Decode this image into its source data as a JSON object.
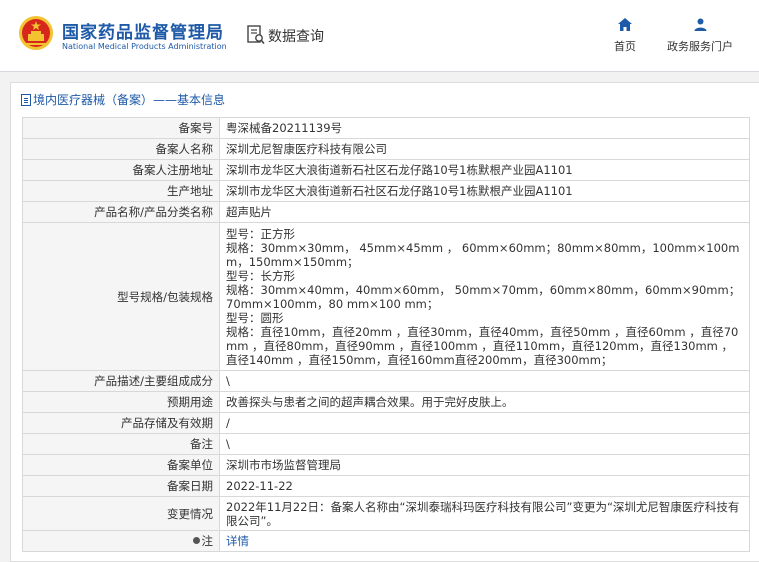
{
  "header": {
    "site_name_cn": "国家药品监督管理局",
    "site_name_en": "National Medical Products Administration",
    "section_title": "数据查询",
    "nav": {
      "home_label": "首页",
      "service_label": "政务服务门户"
    }
  },
  "breadcrumb": {
    "parent": "境内医疗器械（备案）",
    "separator": "——",
    "current": "基本信息"
  },
  "record": {
    "filing_no": {
      "label": "备案号",
      "value": "粤深械备20211139号"
    },
    "filer_name": {
      "label": "备案人名称",
      "value": "深圳尤尼智康医疗科技有限公司"
    },
    "filer_address": {
      "label": "备案人注册地址",
      "value": "深圳市龙华区大浪街道新石社区石龙仔路10号1栋默根产业园A1101"
    },
    "production_address": {
      "label": "生产地址",
      "value": "深圳市龙华区大浪街道新石社区石龙仔路10号1栋默根产业园A1101"
    },
    "product_name": {
      "label": "产品名称/产品分类名称",
      "value": "超声贴片"
    },
    "spec": {
      "label": "型号规格/包装规格",
      "lines": [
        "型号：正方形",
        "规格：30mm×30mm， 45mm×45mm ， 60mm×60mm；80mm×80mm，100mm×100mm，150mm×150mm；",
        "型号：长方形",
        "规格：30mm×40mm，40mm×60mm， 50mm×70mm，60mm×80mm，60mm×90mm；70mm×100mm，80 mm×100 mm；",
        "型号：圆形",
        "规格：直径10mm，直径20mm ，直径30mm，直径40mm，直径50mm ，直径60mm ，直径70mm ，直径80mm，直径90mm ，直径100mm ，直径110mm，直径120mm，直径130mm ，直径140mm ，直径150mm，直径160mm直径200mm，直径300mm；"
      ]
    },
    "description": {
      "label": "产品描述/主要组成成分",
      "value": "\\"
    },
    "intended_use": {
      "label": "预期用途",
      "value": "改善探头与患者之间的超声耦合效果。用于完好皮肤上。"
    },
    "storage": {
      "label": "产品存储及有效期",
      "value": "/"
    },
    "remarks": {
      "label": "备注",
      "value": "\\"
    },
    "filing_unit": {
      "label": "备案单位",
      "value": "深圳市市场监督管理局"
    },
    "filing_date": {
      "label": "备案日期",
      "value": "2022-11-22"
    },
    "change": {
      "label": "变更情况",
      "value": "2022年11月22日：备案人名称由“深圳泰瑞科玛医疗科技有限公司”变更为“深圳尤尼智康医疗科技有限公司”。"
    },
    "note": {
      "label": "注",
      "value": "详情"
    }
  },
  "colors": {
    "brand_blue": "#1e5aa8",
    "emblem_red": "#d7261c",
    "emblem_gold": "#f2c230"
  },
  "icons": [
    "national-emblem-icon",
    "data-query-icon",
    "home-icon",
    "user-icon",
    "document-icon",
    "pin-icon"
  ]
}
